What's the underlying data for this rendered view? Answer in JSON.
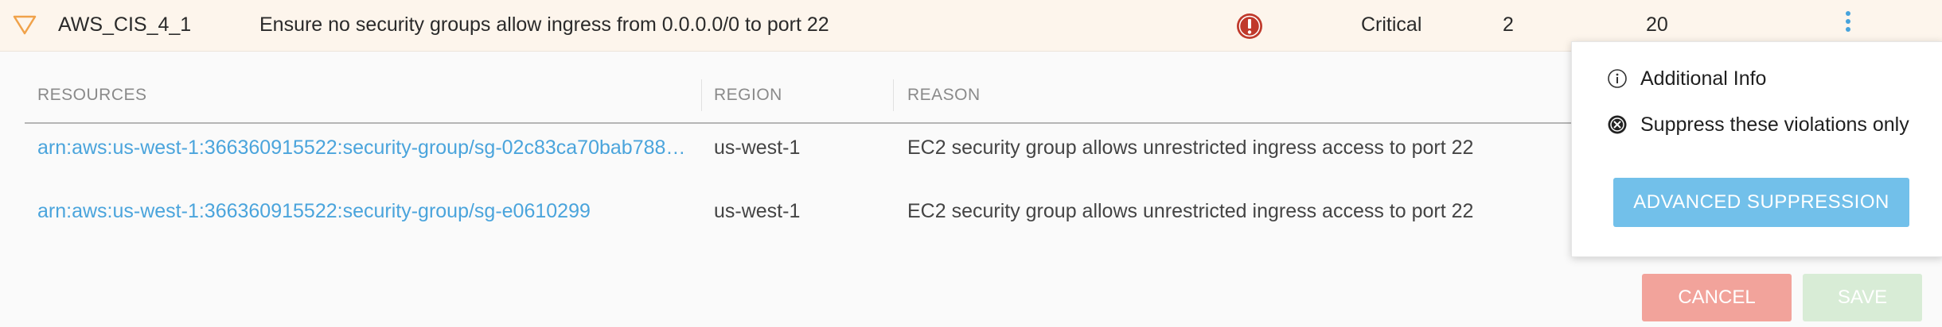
{
  "rule": {
    "id": "AWS_CIS_4_1",
    "description": "Ensure no security groups allow ingress from 0.0.0.0/0 to port 22",
    "severity_icon": "critical-alert-icon",
    "severity": "Critical",
    "count_a": "2",
    "count_b": "20",
    "menu_icon": "kebab-menu-icon"
  },
  "table": {
    "headers": [
      "RESOURCES",
      "REGION",
      "REASON"
    ],
    "rows": [
      {
        "resource": "arn:aws:us-west-1:366360915522:security-group/sg-02c83ca70bab788…",
        "region": "us-west-1",
        "reason": "EC2 security group allows unrestricted ingress access to port 22"
      },
      {
        "resource": "arn:aws:us-west-1:366360915522:security-group/sg-e0610299",
        "region": "us-west-1",
        "reason": "EC2 security group allows unrestricted ingress access to port 22"
      }
    ]
  },
  "popover": {
    "items": [
      {
        "label": "Additional Info",
        "icon": "info-icon"
      },
      {
        "label": "Suppress these violations only",
        "icon": "suppress-icon"
      }
    ],
    "advanced_button": "ADVANCED SUPPRESSION"
  },
  "actions": {
    "cancel": "CANCEL",
    "save": "SAVE"
  },
  "colors": {
    "accent": "#4aa4dc",
    "critical": "#c0392b",
    "caret": "#f0a24a",
    "cancel": "#f2a39b",
    "save_disabled": "#d8ecd6"
  }
}
